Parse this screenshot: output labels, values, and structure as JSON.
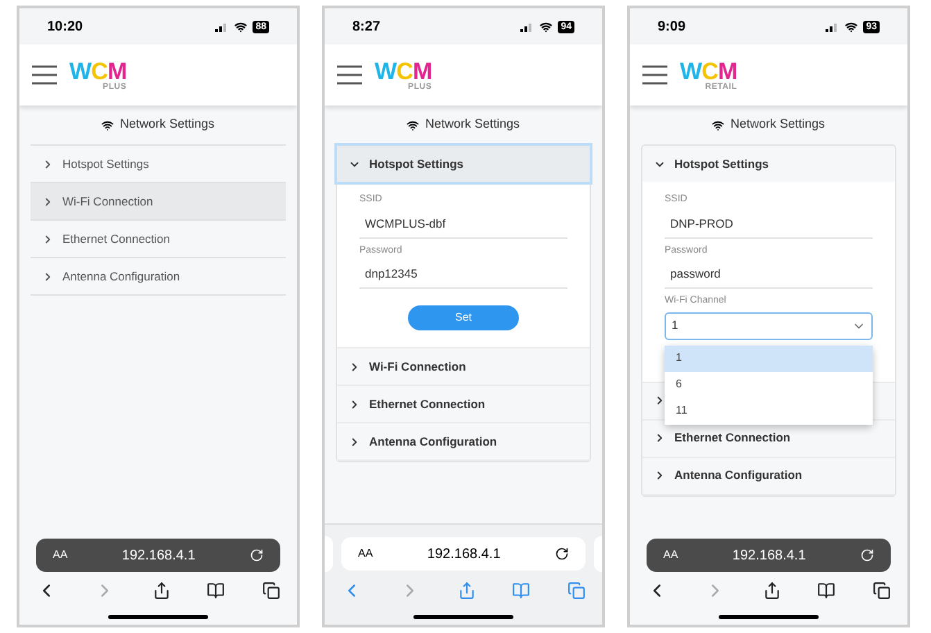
{
  "phones": [
    {
      "status_bar": {
        "time": "10:20",
        "battery": "88"
      },
      "logo": {
        "text": "WCM",
        "subtitle": "PLUS"
      },
      "page_title": "Network Settings",
      "carded": false,
      "sections": [
        {
          "label": "Hotspot Settings",
          "expanded": false,
          "highlighted": false
        },
        {
          "label": "Wi-Fi Connection",
          "expanded": false,
          "highlighted": true
        },
        {
          "label": "Ethernet Connection",
          "expanded": false,
          "highlighted": false
        },
        {
          "label": "Antenna Configuration",
          "expanded": false,
          "highlighted": false
        }
      ],
      "address_bar": {
        "aa": "AA",
        "url": "192.168.4.1",
        "dark": true
      },
      "nav_tinted": false
    },
    {
      "status_bar": {
        "time": "8:27",
        "battery": "94"
      },
      "logo": {
        "text": "WCM",
        "subtitle": "PLUS"
      },
      "page_title": "Network Settings",
      "carded": true,
      "sections": [
        {
          "label": "Hotspot Settings",
          "expanded": true,
          "highlighted": true,
          "fields": [
            {
              "kind": "text",
              "label": "SSID",
              "value": "WCMPLUS-dbf"
            },
            {
              "kind": "text",
              "label": "Password",
              "value": "dnp12345"
            }
          ],
          "button": "Set"
        },
        {
          "label": "Wi-Fi Connection",
          "expanded": false,
          "highlighted": false
        },
        {
          "label": "Ethernet Connection",
          "expanded": false,
          "highlighted": false
        },
        {
          "label": "Antenna Configuration",
          "expanded": false,
          "highlighted": false
        }
      ],
      "address_bar": {
        "aa": "AA",
        "url": "192.168.4.1",
        "dark": false
      },
      "nav_tinted": true
    },
    {
      "status_bar": {
        "time": "9:09",
        "battery": "93"
      },
      "logo": {
        "text": "WCM",
        "subtitle": "RETAIL"
      },
      "page_title": "Network Settings",
      "carded": true,
      "sections": [
        {
          "label": "Hotspot Settings",
          "expanded": true,
          "highlighted": false,
          "fields": [
            {
              "kind": "text",
              "label": "SSID",
              "value": "DNP-PROD"
            },
            {
              "kind": "text",
              "label": "Password",
              "value": "password"
            },
            {
              "kind": "select",
              "label": "Wi-Fi Channel",
              "value": "1",
              "open": true,
              "options": [
                {
                  "label": "1",
                  "selected": true
                },
                {
                  "label": "6",
                  "selected": false
                },
                {
                  "label": "11",
                  "selected": false
                }
              ]
            }
          ]
        },
        {
          "expanded": false,
          "highlighted": false
        },
        {
          "label": "Ethernet Connection",
          "expanded": false,
          "highlighted": false
        },
        {
          "label": "Antenna Configuration",
          "expanded": false,
          "highlighted": false
        }
      ],
      "address_bar": {
        "aa": "AA",
        "url": "192.168.4.1",
        "dark": true
      },
      "nav_tinted": false
    }
  ]
}
